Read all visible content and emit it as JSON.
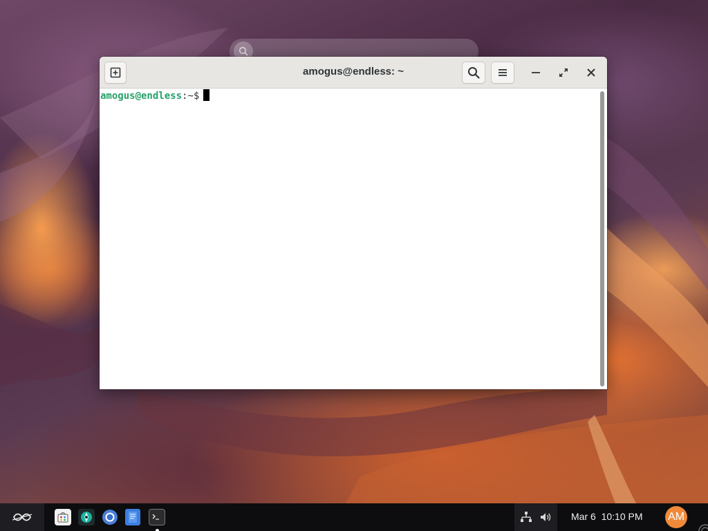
{
  "window": {
    "title": "amogus@endless: ~"
  },
  "terminal": {
    "user_host": "amogus@endless",
    "separator": ":",
    "path": "~",
    "prompt_symbol": "$"
  },
  "taskbar": {
    "apps": [
      {
        "name": "App Center",
        "icon": "app-store-icon"
      },
      {
        "name": "Helper",
        "icon": "helper-app-icon"
      },
      {
        "name": "Chromium",
        "icon": "browser-icon"
      },
      {
        "name": "Files",
        "icon": "files-icon"
      },
      {
        "name": "Terminal",
        "icon": "terminal-icon",
        "running": true
      }
    ],
    "clock": "Mar 6  10:10 PM",
    "avatar_initials": "AM"
  },
  "colors": {
    "prompt_user": "#26a269",
    "avatar_bg": "#f08a3a",
    "taskbar_bg": "#0d0d0f",
    "titlebar_bg": "#e8e6e3"
  }
}
